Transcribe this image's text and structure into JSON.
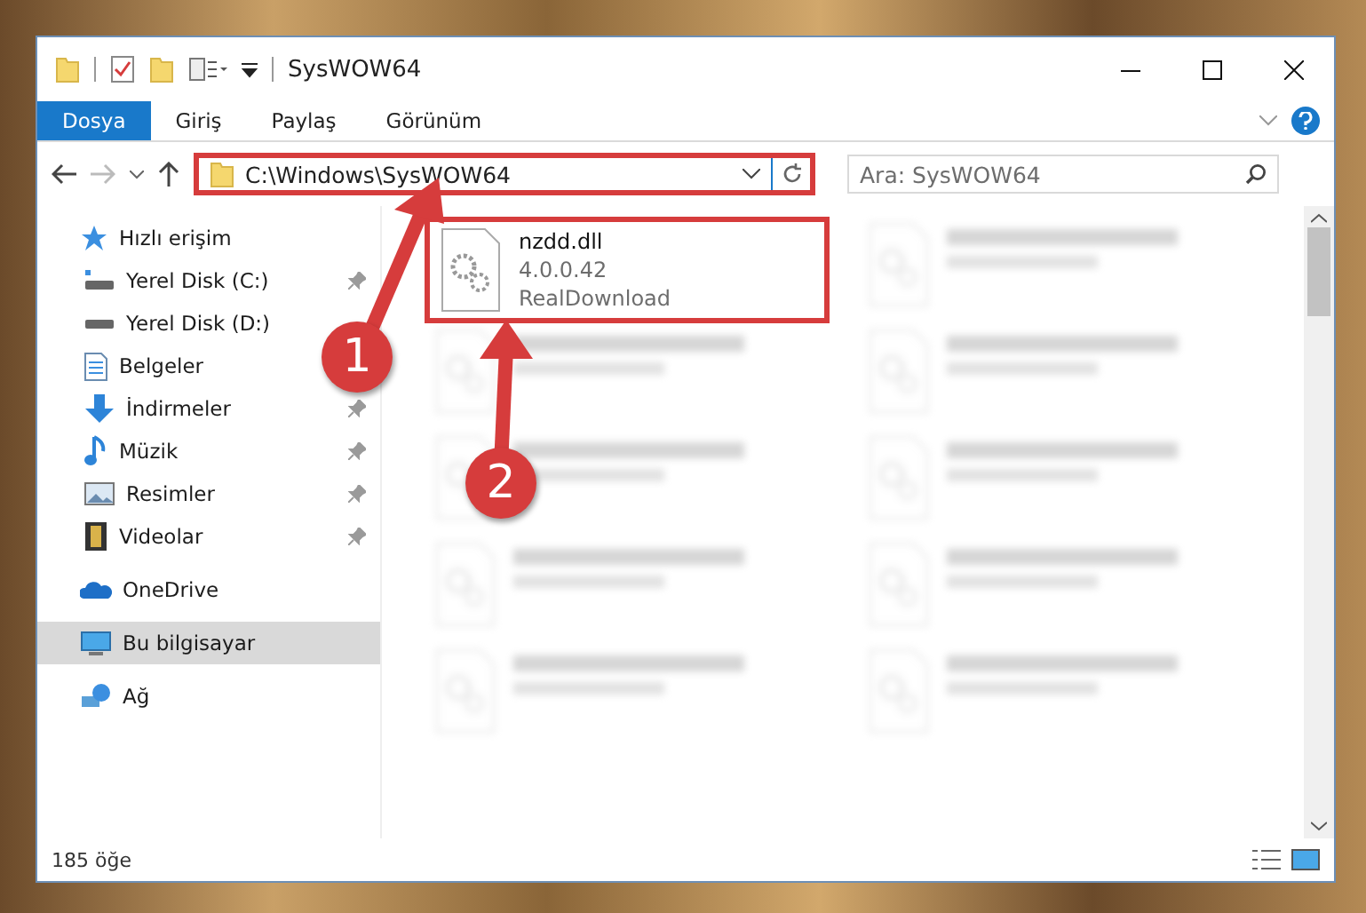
{
  "window": {
    "title": "SysWOW64"
  },
  "ribbon": {
    "tabs": [
      {
        "label": "Dosya",
        "selected": true
      },
      {
        "label": "Giriş",
        "selected": false
      },
      {
        "label": "Paylaş",
        "selected": false
      },
      {
        "label": "Görünüm",
        "selected": false
      }
    ]
  },
  "address_bar": {
    "path": "C:\\Windows\\SysWOW64",
    "highlighted": true
  },
  "search": {
    "placeholder": "Ara: SysWOW64"
  },
  "sidebar": {
    "items": [
      {
        "label": "Hızlı erişim",
        "selected": false,
        "children": [
          {
            "label": "Yerel Disk (C:)",
            "pinned": true,
            "selected": false
          },
          {
            "label": "Yerel Disk (D:)",
            "pinned": false,
            "selected": false
          },
          {
            "label": "Belgeler",
            "pinned": false,
            "selected": false
          },
          {
            "label": "İndirmeler",
            "pinned": true,
            "selected": false
          },
          {
            "label": "Müzik",
            "pinned": true,
            "selected": false
          },
          {
            "label": "Resimler",
            "pinned": true,
            "selected": false
          },
          {
            "label": "Videolar",
            "pinned": true,
            "selected": false
          }
        ]
      },
      {
        "label": "OneDrive",
        "selected": false
      },
      {
        "label": "Bu bilgisayar",
        "selected": true
      },
      {
        "label": "Ağ",
        "selected": false
      }
    ]
  },
  "files": [
    {
      "kind": "clear",
      "name": "nzdd.dll",
      "version": "4.0.0.42",
      "company": "RealDownload",
      "highlighted": true
    },
    {
      "kind": "blurred"
    },
    {
      "kind": "blurred"
    },
    {
      "kind": "blurred"
    },
    {
      "kind": "blurred"
    },
    {
      "kind": "blurred"
    },
    {
      "kind": "blurred"
    },
    {
      "kind": "blurred"
    },
    {
      "kind": "blurred"
    },
    {
      "kind": "blurred"
    }
  ],
  "status_bar": {
    "count": "185 öğe"
  },
  "annotations": [
    {
      "number": "1"
    },
    {
      "number": "2"
    }
  ]
}
